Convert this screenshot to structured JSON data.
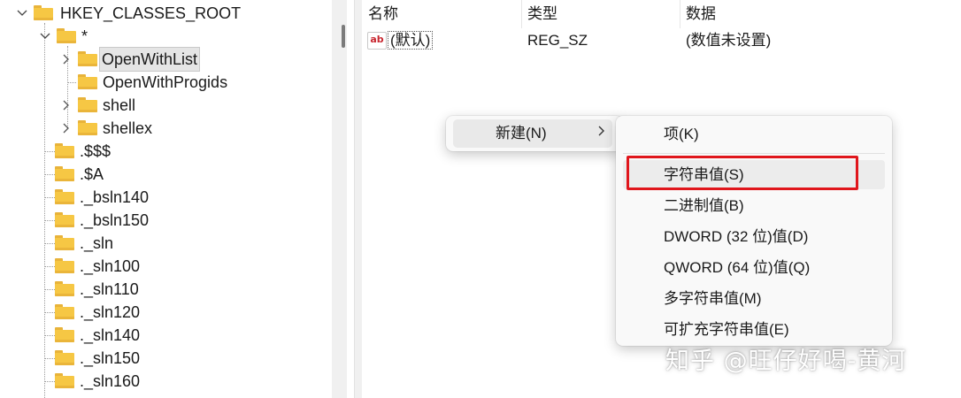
{
  "tree": {
    "root": "HKEY_CLASSES_ROOT",
    "star": "*",
    "children": [
      "OpenWithList",
      "OpenWithProgids",
      "shell",
      "shellex"
    ],
    "items": [
      ".$$$",
      ".$A",
      "._bsln140",
      "._bsln150",
      "._sln",
      "._sln100",
      "._sln110",
      "._sln120",
      "._sln140",
      "._sln150",
      "._sln160"
    ]
  },
  "values": {
    "headers": {
      "name": "名称",
      "type": "类型",
      "data": "数据"
    },
    "rows": [
      {
        "icon": "ab-string-icon",
        "icon_text": "ab",
        "name": "(默认)",
        "type": "REG_SZ",
        "data": "(数值未设置)"
      }
    ]
  },
  "context_menu": {
    "new_label": "新建(N)",
    "submenu": [
      "项(K)",
      "字符串值(S)",
      "二进制值(B)",
      "DWORD (32 位)值(D)",
      "QWORD (64 位)值(Q)",
      "多字符串值(M)",
      "可扩充字符串值(E)"
    ]
  },
  "watermark": "知乎 @旺仔好喝-黄河",
  "colors": {
    "highlight": "#e0161c",
    "folder": "#f6c744",
    "selection": "#e5e5e5"
  }
}
